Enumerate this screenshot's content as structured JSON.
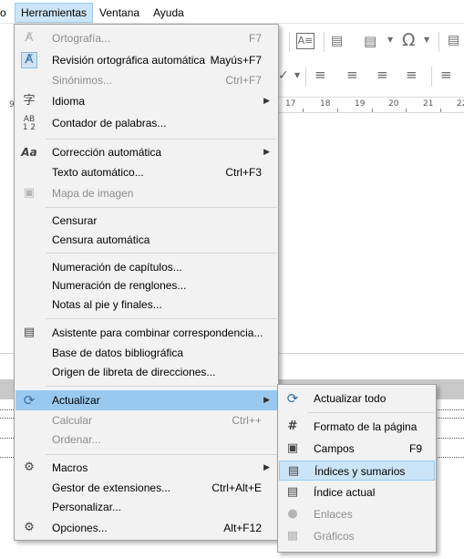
{
  "menubar": {
    "items": [
      {
        "label": "o"
      },
      {
        "label": "Herramientas"
      },
      {
        "label": "Ventana"
      },
      {
        "label": "Ayuda"
      }
    ]
  },
  "ruler": {
    "ticks": [
      "17",
      "18",
      "19",
      "20",
      "21",
      "22"
    ]
  },
  "left_ruler_fragment": "9",
  "toolbar_icons": [
    "text-box-icon",
    "table-icon",
    "page-icon",
    "omega-special-char-icon",
    "comment-icon",
    "align-left-icon",
    "align-center-icon",
    "align-right-icon",
    "justify-icon",
    "line-spacing-icon"
  ],
  "tools_menu": {
    "items": [
      {
        "label": "Ortografía...",
        "shortcut": "F7",
        "icon": "spelling-icon",
        "enabled": false
      },
      {
        "label": "Revisión ortográfica automática",
        "shortcut": "Mayús+F7",
        "icon": "auto-spellcheck-icon",
        "enabled": true,
        "checked": true
      },
      {
        "label": "Sinónimos...",
        "shortcut": "Ctrl+F7",
        "icon": "",
        "enabled": false
      },
      {
        "label": "Idioma",
        "shortcut": "",
        "icon": "language-icon",
        "enabled": true,
        "submenu": true
      },
      {
        "label": "Contador de palabras...",
        "shortcut": "",
        "icon": "word-count-icon",
        "enabled": true
      },
      {
        "label": "Corrección automática",
        "shortcut": "",
        "icon": "autocorrect-icon",
        "enabled": true,
        "submenu": true
      },
      {
        "label": "Texto automático...",
        "shortcut": "Ctrl+F3",
        "icon": "",
        "enabled": true
      },
      {
        "label": "Mapa de imagen",
        "shortcut": "",
        "icon": "image-map-icon",
        "enabled": false
      },
      {
        "label": "Censurar",
        "shortcut": "",
        "icon": "",
        "enabled": true
      },
      {
        "label": "Censura automática",
        "shortcut": "",
        "icon": "",
        "enabled": true
      },
      {
        "label": "Numeración de capítulos...",
        "shortcut": "",
        "icon": "",
        "enabled": true
      },
      {
        "label": "Numeración de renglones...",
        "shortcut": "",
        "icon": "",
        "enabled": true
      },
      {
        "label": "Notas al pie y finales...",
        "shortcut": "",
        "icon": "",
        "enabled": true
      },
      {
        "label": "Asistente para combinar correspondencia...",
        "shortcut": "",
        "icon": "mail-merge-icon",
        "enabled": true
      },
      {
        "label": "Base de datos bibliográfica",
        "shortcut": "",
        "icon": "",
        "enabled": true
      },
      {
        "label": "Origen de libreta de direcciones...",
        "shortcut": "",
        "icon": "",
        "enabled": true
      },
      {
        "label": "Actualizar",
        "shortcut": "",
        "icon": "update-icon",
        "enabled": true,
        "submenu": true,
        "highlighted": true
      },
      {
        "label": "Calcular",
        "shortcut": "Ctrl++",
        "icon": "",
        "enabled": false
      },
      {
        "label": "Ordenar...",
        "shortcut": "",
        "icon": "",
        "enabled": false
      },
      {
        "label": "Macros",
        "shortcut": "",
        "icon": "macros-icon",
        "enabled": true,
        "submenu": true
      },
      {
        "label": "Gestor de extensiones...",
        "shortcut": "Ctrl+Alt+E",
        "icon": "",
        "enabled": true
      },
      {
        "label": "Personalizar...",
        "shortcut": "",
        "icon": "",
        "enabled": true
      },
      {
        "label": "Opciones...",
        "shortcut": "Alt+F12",
        "icon": "options-gear-icon",
        "enabled": true
      }
    ]
  },
  "update_submenu": {
    "items": [
      {
        "label": "Actualizar todo",
        "shortcut": "",
        "icon": "update-all-icon",
        "enabled": true
      },
      {
        "label": "Formato de la página",
        "shortcut": "",
        "icon": "page-format-icon",
        "enabled": true
      },
      {
        "label": "Campos",
        "shortcut": "F9",
        "icon": "fields-icon",
        "enabled": true
      },
      {
        "label": "Índices y sumarios",
        "shortcut": "",
        "icon": "indexes-icon",
        "enabled": true,
        "highlighted": true
      },
      {
        "label": "Índice actual",
        "shortcut": "",
        "icon": "current-index-icon",
        "enabled": true
      },
      {
        "label": "Enlaces",
        "shortcut": "",
        "icon": "links-globe-icon",
        "enabled": false
      },
      {
        "label": "Gráficos",
        "shortcut": "",
        "icon": "charts-icon",
        "enabled": false
      }
    ]
  },
  "colors": {
    "menu_bg": "#f2f2f2",
    "highlight": "#99c9ef",
    "highlight_light": "#cce4f7",
    "disabled_text": "#8c8c8c"
  }
}
